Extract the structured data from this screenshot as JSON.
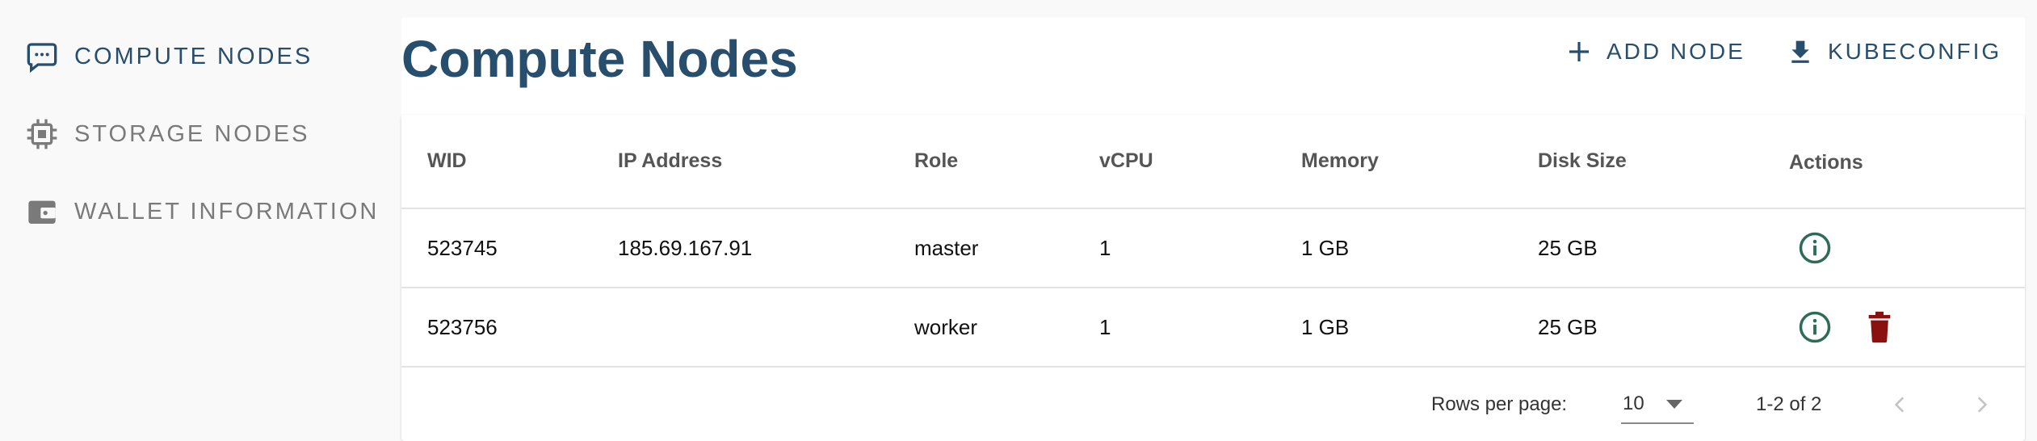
{
  "sidebar": {
    "items": [
      {
        "label": "COMPUTE NODES",
        "icon": "chat-dots-icon",
        "active": true
      },
      {
        "label": "STORAGE NODES",
        "icon": "chip-icon",
        "active": false
      },
      {
        "label": "WALLET INFORMATION",
        "icon": "wallet-icon",
        "active": false
      }
    ]
  },
  "main": {
    "title": "Compute Nodes",
    "add_node_label": "ADD NODE",
    "kubeconfig_label": "KUBECONFIG"
  },
  "table": {
    "columns": [
      "WID",
      "IP Address",
      "Role",
      "vCPU",
      "Memory",
      "Disk Size",
      "Actions"
    ],
    "rows": [
      {
        "wid": "523745",
        "ip": "185.69.167.91",
        "role": "master",
        "vcpu": "1",
        "memory": "1 GB",
        "disk": "25 GB"
      },
      {
        "wid": "523756",
        "ip": "",
        "role": "worker",
        "vcpu": "1",
        "memory": "1 GB",
        "disk": "25 GB"
      }
    ]
  },
  "pagination": {
    "rows_per_page_label": "Rows per page:",
    "rows_per_page": "10",
    "range": "1-2 of 2"
  },
  "colors": {
    "primary": "#284e6e",
    "info": "#2e6b58",
    "danger": "#8b1111",
    "muted": "#7a7a7a"
  }
}
